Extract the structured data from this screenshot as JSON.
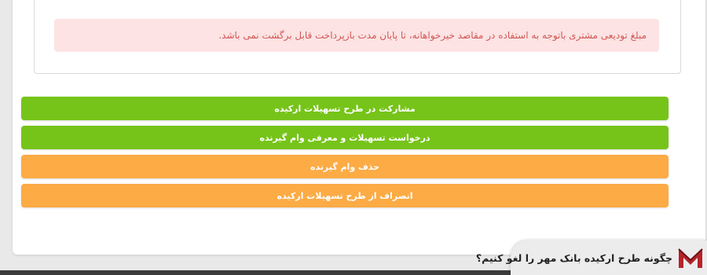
{
  "notice": {
    "text": "مبلغ تودیعی مشتری باتوجه به استفاده در مقاصد خیرخواهانه، تا پایان مدت بازپرداخت قابل برگشت نمی باشد."
  },
  "actions": [
    {
      "label": "مشارکت در طرح تسهیلات ارکیده",
      "color": "#76c41a"
    },
    {
      "label": "درخواست تسهیلات و معرفی وام گیرنده",
      "color": "#76c41a"
    },
    {
      "label": "حذف وام گیرنده",
      "color": "#fcab45"
    },
    {
      "label": "انصراف از طرح تسهیلات ارکیده",
      "color": "#fcab45"
    }
  ],
  "promo": {
    "text": "چگونه طرح ارکیده بانک مهر را لغو کنیم؟",
    "logo_icon": "site-logo-icon",
    "logo_color": "#b5232a"
  }
}
